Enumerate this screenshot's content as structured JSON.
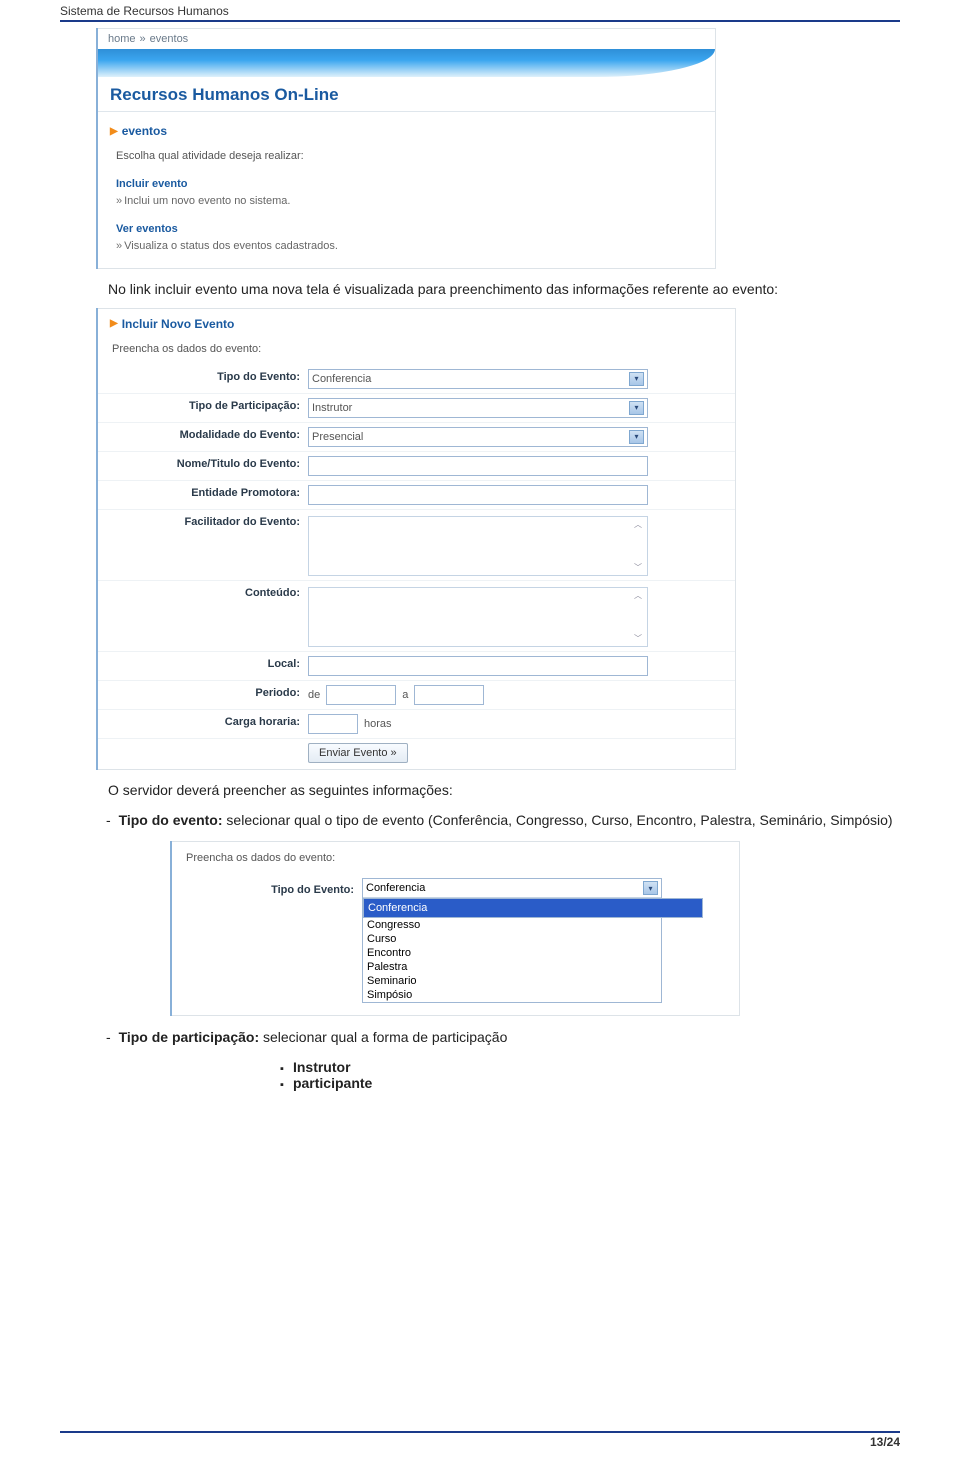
{
  "doc_title": "Sistema de Recursos Humanos",
  "page_number": "13/24",
  "shot1": {
    "breadcrumb_home": "home",
    "breadcrumb_sep": "»",
    "breadcrumb_current": "eventos",
    "module_title": "Recursos Humanos On-Line",
    "section_title": "eventos",
    "prompt": "Escolha qual atividade deseja realizar:",
    "link1_title": "Incluir evento",
    "link1_desc": "Inclui um novo evento no sistema.",
    "link2_title": "Ver eventos",
    "link2_desc": "Visualiza o status dos eventos cadastrados."
  },
  "para1": "No link incluir evento uma nova tela é visualizada para preenchimento das informações referente ao evento:",
  "shot2": {
    "section_title": "Incluir Novo Evento",
    "instruction": "Preencha os dados do evento:",
    "labels": {
      "tipo_evento": "Tipo do Evento:",
      "tipo_participacao": "Tipo de Participação:",
      "modalidade": "Modalidade do Evento:",
      "nome_titulo": "Nome/Titulo do Evento:",
      "entidade": "Entidade Promotora:",
      "facilitador": "Facilitador do Evento:",
      "conteudo": "Conteúdo:",
      "local": "Local:",
      "periodo": "Periodo:",
      "carga": "Carga horaria:"
    },
    "values": {
      "tipo_evento": "Conferencia",
      "tipo_participacao": "Instrutor",
      "modalidade": "Presencial",
      "periodo_de": "de",
      "periodo_a": "a",
      "carga_unit": "horas"
    },
    "submit": "Enviar Evento »"
  },
  "para2_lead": "O servidor deverá preencher as seguintes informações:",
  "bullet1_label": "Tipo do evento:",
  "bullet1_text": " selecionar qual o tipo de evento (Conferência, Congresso, Curso, Encontro, Palestra, Seminário, Simpósio)",
  "shot3": {
    "instruction": "Preencha os dados do evento:",
    "label": "Tipo do Evento:",
    "selected": "Conferencia",
    "options": [
      "Conferencia",
      "Congresso",
      "Curso",
      "Encontro",
      "Palestra",
      "Seminario",
      "Simpósio"
    ]
  },
  "bullet2_label": "Tipo de participação:",
  "bullet2_text": " selecionar qual a forma de participação",
  "sub_bullets": [
    "Instrutor",
    "participante"
  ]
}
